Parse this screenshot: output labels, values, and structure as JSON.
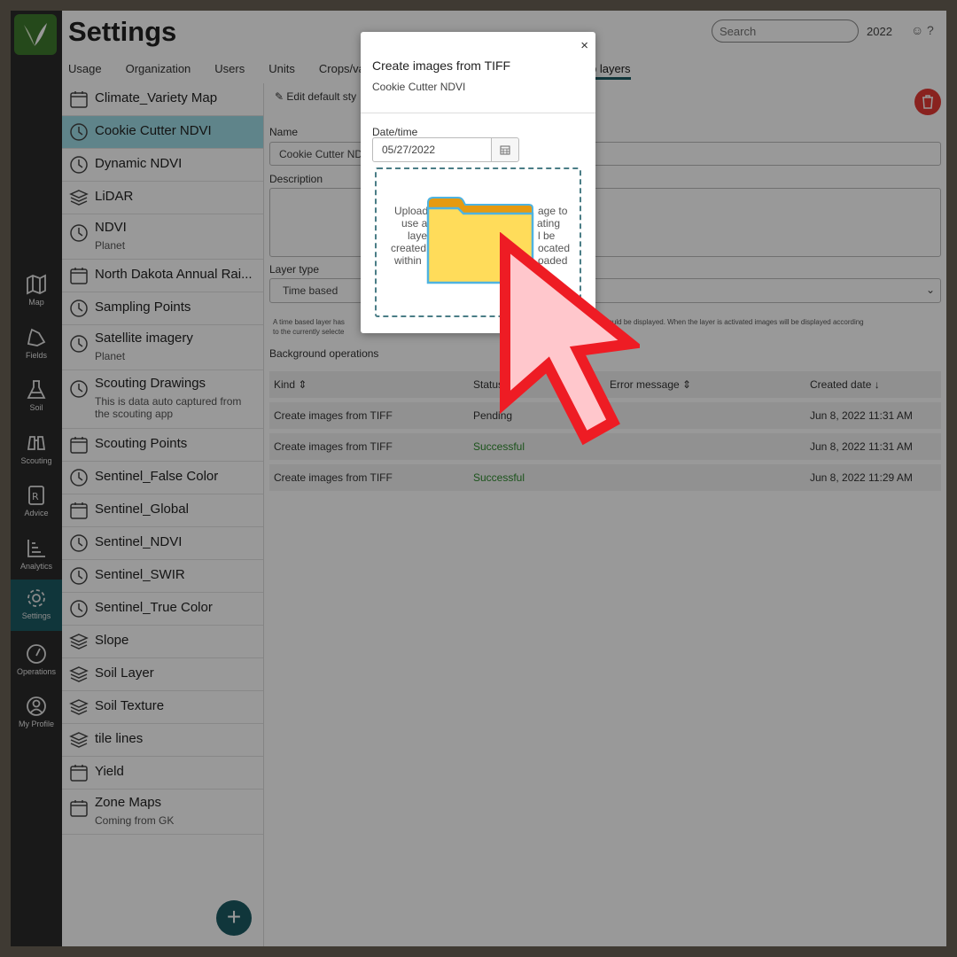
{
  "app": {
    "title": "Settings",
    "search_placeholder": "Search",
    "year": "2022",
    "smile_glyph": "☺",
    "help_glyph": "?"
  },
  "tabs": [
    "Usage",
    "Organization",
    "Users",
    "Units",
    "Crops/var"
  ],
  "active_tab": "p layers",
  "nav": [
    {
      "label": "Map",
      "icon": "map-icon"
    },
    {
      "label": "Fields",
      "icon": "fields-icon"
    },
    {
      "label": "Soil",
      "icon": "flask-icon"
    },
    {
      "label": "Scouting",
      "icon": "binoculars-icon"
    },
    {
      "label": "Advice",
      "icon": "prescription-icon"
    },
    {
      "label": "Analytics",
      "icon": "chart-icon"
    },
    {
      "label": "Settings",
      "icon": "gear-icon"
    },
    {
      "label": "Operations",
      "icon": "gauge-icon"
    },
    {
      "label": "My Profile",
      "icon": "user-icon"
    }
  ],
  "layers": [
    {
      "name": "Climate_Variety Map",
      "icon": "calendar-icon"
    },
    {
      "name": "Cookie Cutter NDVI",
      "icon": "clock-icon"
    },
    {
      "name": "Dynamic NDVI",
      "icon": "clock-icon"
    },
    {
      "name": "LiDAR",
      "icon": "layers-icon"
    },
    {
      "name": "NDVI",
      "sub": "Planet",
      "icon": "clock-icon"
    },
    {
      "name": "North Dakota Annual Rai...",
      "icon": "calendar-icon"
    },
    {
      "name": "Sampling Points",
      "icon": "clock-icon"
    },
    {
      "name": "Satellite imagery",
      "sub": "Planet",
      "icon": "clock-icon"
    },
    {
      "name": "Scouting Drawings",
      "sub": "This is data auto captured from the scouting app",
      "icon": "clock-icon"
    },
    {
      "name": "Scouting Points",
      "icon": "calendar-icon"
    },
    {
      "name": "Sentinel_False Color",
      "icon": "clock-icon"
    },
    {
      "name": "Sentinel_Global",
      "icon": "calendar-icon"
    },
    {
      "name": "Sentinel_NDVI",
      "icon": "clock-icon"
    },
    {
      "name": "Sentinel_SWIR",
      "icon": "clock-icon"
    },
    {
      "name": "Sentinel_True Color",
      "icon": "clock-icon"
    },
    {
      "name": "Slope",
      "icon": "layers-icon"
    },
    {
      "name": "Soil Layer",
      "icon": "layers-icon"
    },
    {
      "name": "Soil Texture",
      "icon": "layers-icon"
    },
    {
      "name": "tile lines",
      "icon": "layers-icon"
    },
    {
      "name": "Yield",
      "icon": "calendar-icon"
    },
    {
      "name": "Zone Maps",
      "sub": "Coming from GK",
      "icon": "calendar-icon"
    }
  ],
  "detail": {
    "edit_style": "Edit default sty",
    "name_label": "Name",
    "name_value": "Cookie Cutter ND",
    "description_label": "Description",
    "layer_type_label": "Layer type",
    "layer_type_value": "Time based",
    "help_text_left": "A time based layer has",
    "help_text_right": "nage should be displayed. When the layer is activated images will be displayed according",
    "help_text_line2": "to the currently selecte",
    "bg_ops_label": "Background operations"
  },
  "ops_table": {
    "headers": [
      "Kind",
      "Status",
      "Error message",
      "Created date"
    ],
    "rows": [
      [
        "Create images from TIFF",
        "Pending",
        "",
        "Jun 8, 2022 11:31 AM"
      ],
      [
        "Create images from TIFF",
        "Successful",
        "",
        "Jun 8, 2022 11:31 AM"
      ],
      [
        "Create images from TIFF",
        "Successful",
        "",
        "Jun 8, 2022 11:29 AM"
      ]
    ]
  },
  "modal": {
    "title": "Create images from TIFF",
    "subtitle": "Cookie Cutter NDVI",
    "close_glyph": "×",
    "date_label": "Date/time",
    "date_value": "05/27/2022",
    "dropzone_lines": [
      "Upload",
      "age to",
      "use a",
      "ating",
      "laye",
      "l be",
      "created",
      "ocated",
      "within",
      "oaded"
    ]
  },
  "colors": {
    "accent": "#1b5a63",
    "active_item": "#9fdde6",
    "delete": "#e53935",
    "success": "#2e8b2e",
    "cursor": "#ee1c24",
    "folder": "#ffdc5a"
  }
}
